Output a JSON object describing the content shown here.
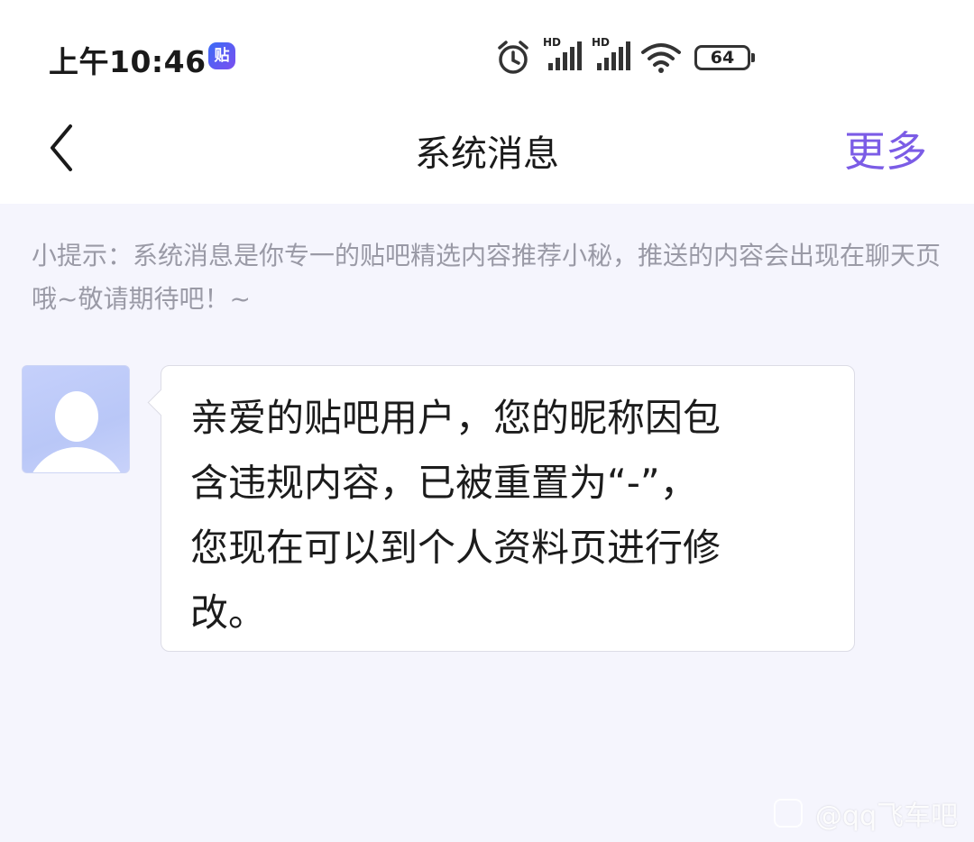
{
  "status_bar": {
    "time": "上午10:46",
    "app_badge": "贴",
    "icons": [
      "alarm-icon",
      "signal-hd-icon",
      "signal-hd-icon",
      "wifi-icon"
    ],
    "signal_label": "HD",
    "battery": "64"
  },
  "nav": {
    "title": "系统消息",
    "more_label": "更多"
  },
  "tip": "小提示：系统消息是你专一的贴吧精选内容推荐小秘，推送的内容会出现在聊天页哦~敬请期待吧！~",
  "message": {
    "text": "亲爱的贴吧用户，您的昵称因包\n含违规内容，已被重置为“-”，\n您现在可以到个人资料页进行修\n改。"
  },
  "watermark": "@qq飞车吧",
  "colors": {
    "accent": "#7b5ce6",
    "background": "#f5f5fd",
    "tip_text": "#9a9aa6"
  }
}
